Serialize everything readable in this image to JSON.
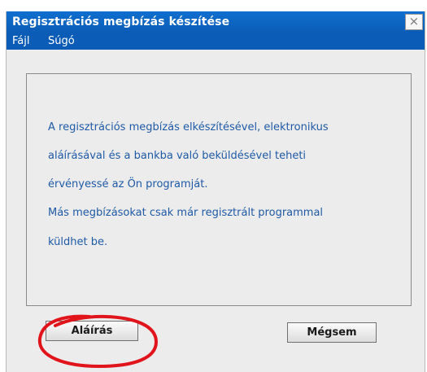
{
  "window": {
    "title": "Regisztrációs megbízás készítése",
    "close_glyph": "×"
  },
  "menu": {
    "items": [
      {
        "label": "Fájl"
      },
      {
        "label": "Súgó"
      }
    ]
  },
  "message": {
    "lines": [
      "A regisztrációs megbízás elkészítésével, elektronikus",
      "aláírásával és a bankba való beküldésével teheti",
      "érvényessé az Ön programját.",
      "Más megbízásokat csak már regisztrált programmal",
      "küldhet be."
    ]
  },
  "buttons": {
    "sign_label": "Aláírás",
    "cancel_label": "Mégsem"
  },
  "colors": {
    "titlebar": "#0f6fcf",
    "menubar": "#0b5cb7",
    "message_text": "#1f5aa6",
    "annotation": "#e0141a"
  }
}
